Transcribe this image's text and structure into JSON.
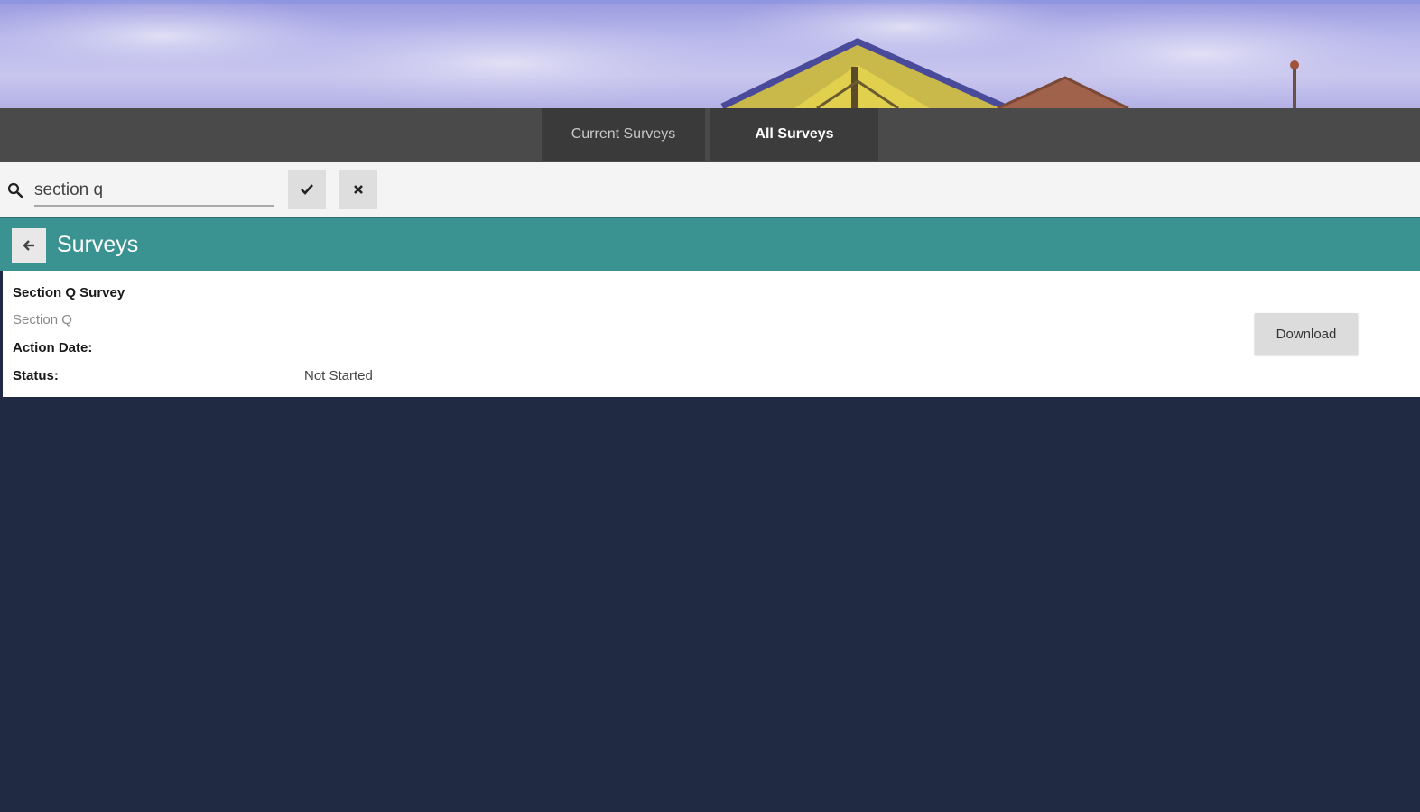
{
  "banner": {
    "image": "building-roof-sky-photo"
  },
  "tabs": [
    {
      "label": "Current Surveys",
      "active": false
    },
    {
      "label": "All Surveys",
      "active": true
    }
  ],
  "search": {
    "value": "section q",
    "icon": "search-icon",
    "confirm_icon": "check-icon",
    "clear_icon": "close-icon"
  },
  "header": {
    "title": "Surveys",
    "back_icon": "arrow-left-icon",
    "color": "#3a9291"
  },
  "surveys": [
    {
      "title": "Section Q Survey",
      "subtitle": "Section Q",
      "action_date_label": "Action Date:",
      "status_label": "Status:",
      "status_value": "Not Started",
      "button_label": "Download"
    }
  ],
  "colors": {
    "page_background": "#202a42",
    "tab_bar": "#4a4a4a",
    "accent": "#3a9291"
  }
}
